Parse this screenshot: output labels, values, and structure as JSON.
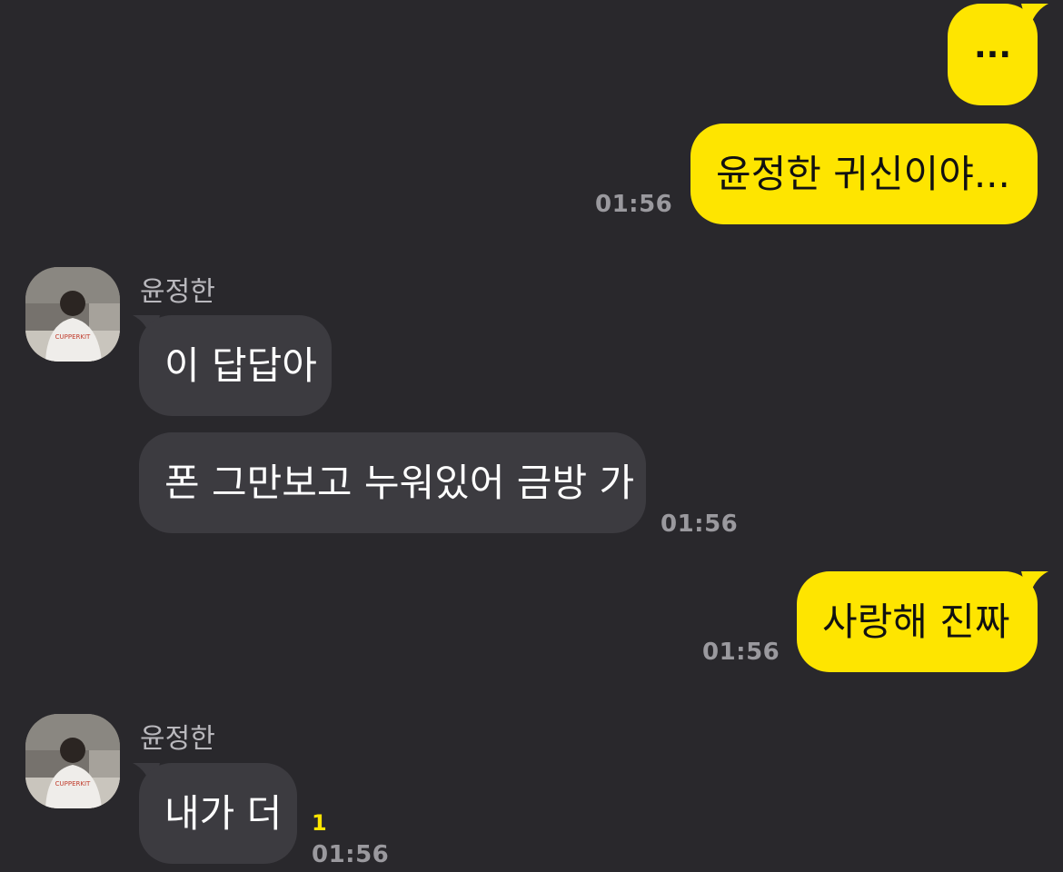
{
  "contact": {
    "name": "윤정한"
  },
  "messages": [
    {
      "id": "m1",
      "side": "me",
      "text": "...",
      "time": ""
    },
    {
      "id": "m2",
      "side": "me",
      "text": "윤정한 귀신이야...",
      "time": "01:56"
    },
    {
      "id": "m3",
      "side": "other",
      "text": "이 답답아",
      "time": ""
    },
    {
      "id": "m4",
      "side": "other",
      "text": "폰 그만보고 누워있어 금방 가",
      "time": "01:56"
    },
    {
      "id": "m5",
      "side": "me",
      "text": "사랑해 진짜",
      "time": "01:56"
    },
    {
      "id": "m6",
      "side": "other",
      "text": "내가 더",
      "time": "01:56",
      "unread": "1"
    }
  ],
  "avatar_print": "CUPPERKIT",
  "colors": {
    "background": "#29282c",
    "my_bubble": "#fee500",
    "other_bubble": "#3c3b40",
    "timestamp": "#9a999e",
    "unread": "#fee500"
  }
}
